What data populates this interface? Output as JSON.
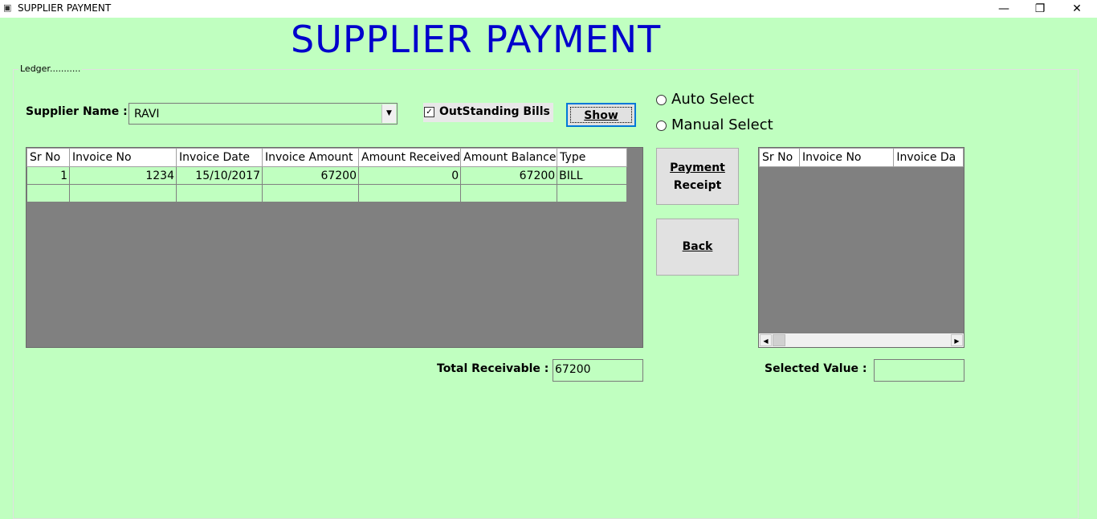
{
  "window": {
    "title": "SUPPLIER PAYMENT",
    "minimize": "—",
    "restore": "❐",
    "close": "✕"
  },
  "heading": "SUPPLIER PAYMENT",
  "group": {
    "label": "Ledger..........."
  },
  "supplier": {
    "label": "Supplier Name :",
    "value": "RAVI"
  },
  "outstanding": {
    "label": "OutStanding Bills",
    "checked": true
  },
  "buttons": {
    "show": "Show",
    "payment_receipt_line1": "Payment",
    "payment_receipt_line2": "Receipt",
    "back": "Back"
  },
  "radios": {
    "auto": "Auto Select",
    "manual": "Manual Select"
  },
  "main_grid": {
    "headers": [
      "Sr No",
      "Invoice No",
      "Invoice Date",
      "Invoice Amount",
      "Amount Received",
      "Amount Balance",
      "Type"
    ],
    "rows": [
      [
        "1",
        "1234",
        "15/10/2017",
        "67200",
        "0",
        "67200",
        "BILL"
      ],
      [
        "",
        "",
        "",
        "",
        "",
        "",
        ""
      ]
    ]
  },
  "side_grid": {
    "headers": [
      "Sr No",
      "Invoice No",
      "Invoice Da"
    ]
  },
  "total_receivable": {
    "label": "Total Receivable :",
    "value": "67200"
  },
  "selected_value": {
    "label": "Selected Value :",
    "value": ""
  },
  "colors": {
    "background": "#c0ffc0",
    "title": "#0000cc",
    "grid_empty": "#808080"
  }
}
